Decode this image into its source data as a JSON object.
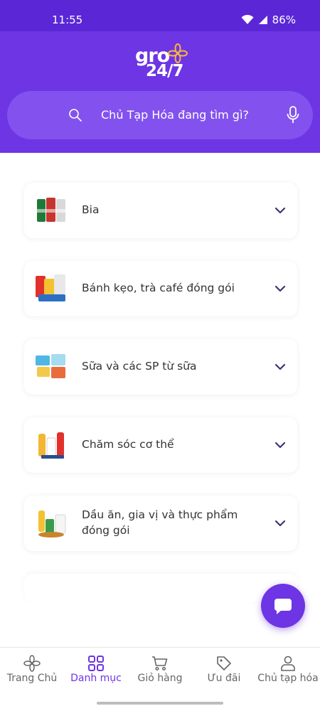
{
  "status_bar": {
    "time": "11:55",
    "battery": "86%"
  },
  "header": {
    "logo_line1": "gro",
    "logo_line2": "24/7"
  },
  "search": {
    "placeholder": "Chủ Tạp Hóa đang tìm gì?"
  },
  "categories": [
    {
      "label": "Bia",
      "icon": "beer-cans-icon"
    },
    {
      "label": "Bánh kẹo, trà café đóng gói",
      "icon": "snacks-icon"
    },
    {
      "label": "Sữa và các SP từ sữa",
      "icon": "milk-products-icon"
    },
    {
      "label": "Chăm sóc cơ thể",
      "icon": "body-care-icon"
    },
    {
      "label": "Dầu ăn, gia vị và thực phẩm đóng gói",
      "icon": "cooking-oil-icon"
    }
  ],
  "bottom_nav": [
    {
      "label": "Trang Chủ",
      "icon": "flower-home-icon",
      "active": false
    },
    {
      "label": "Danh mục",
      "icon": "grid-icon",
      "active": true
    },
    {
      "label": "Giỏ hàng",
      "icon": "cart-icon",
      "active": false
    },
    {
      "label": "Ưu đãi",
      "icon": "tag-icon",
      "active": false
    },
    {
      "label": "Chủ tạp hóa",
      "icon": "user-icon",
      "active": false
    }
  ],
  "colors": {
    "brand": "#6d35e4",
    "status_bar": "#5b27d6",
    "search_bg": "#8352ee"
  }
}
